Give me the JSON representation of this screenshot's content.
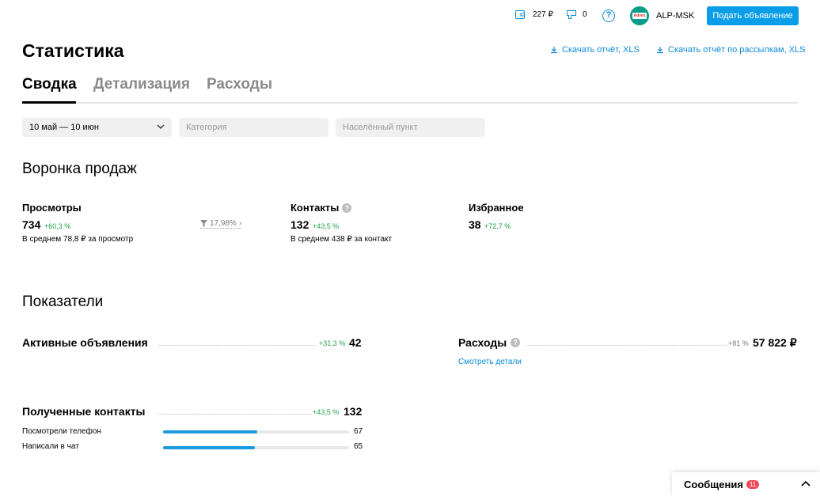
{
  "topbar": {
    "wallet_amount": "227 ₽",
    "bonus_count": "0",
    "help_glyph": "?",
    "avatar_text": "Advex",
    "account_name": "ALP-MSK",
    "post_ad_label": "Подать объявление"
  },
  "page": {
    "title": "Статистика",
    "download_xls": "Скачать отчёт, XLS",
    "download_mailings_xls": "Скачать отчёт по рассылкам, XLS"
  },
  "tabs": [
    {
      "label": "Сводка",
      "active": true
    },
    {
      "label": "Детализация",
      "active": false
    },
    {
      "label": "Расходы",
      "active": false
    }
  ],
  "filters": {
    "period_value": "10 май — 10 июн",
    "category_placeholder": "Категория",
    "city_placeholder": "Населённый пункт"
  },
  "funnel": {
    "title": "Воронка продаж",
    "views": {
      "label": "Просмотры",
      "value": "734",
      "change": "+60,3 %",
      "sub": "В среднем 78,8 ₽ за просмотр",
      "conversion": "17,98%"
    },
    "contacts": {
      "label": "Контакты",
      "value": "132",
      "change": "+43,5 %",
      "sub": "В среднем 438 ₽ за контакт"
    },
    "favorites": {
      "label": "Избранное",
      "value": "38",
      "change": "+72,7 %"
    }
  },
  "metrics": {
    "title": "Показатели",
    "active_ads": {
      "label": "Активные объявления",
      "change": "+31,3 %",
      "value": "42"
    },
    "expenses": {
      "label": "Расходы",
      "change": "+81 %",
      "value": "57 822 ₽",
      "details_link": "Смотреть детали"
    },
    "received_contacts": {
      "label": "Полученные контакты",
      "change": "+43,5 %",
      "value": "132",
      "rows": [
        {
          "label": "Посмотрели телефон",
          "value": "67",
          "fraction": 0.508
        },
        {
          "label": "Написали в чат",
          "value": "65",
          "fraction": 0.492
        }
      ]
    }
  },
  "messages": {
    "label": "Сообщения",
    "badge": "11"
  },
  "colors": {
    "accent": "#0a8bd6",
    "positive": "#1fa34a",
    "badge": "#f0485a"
  }
}
